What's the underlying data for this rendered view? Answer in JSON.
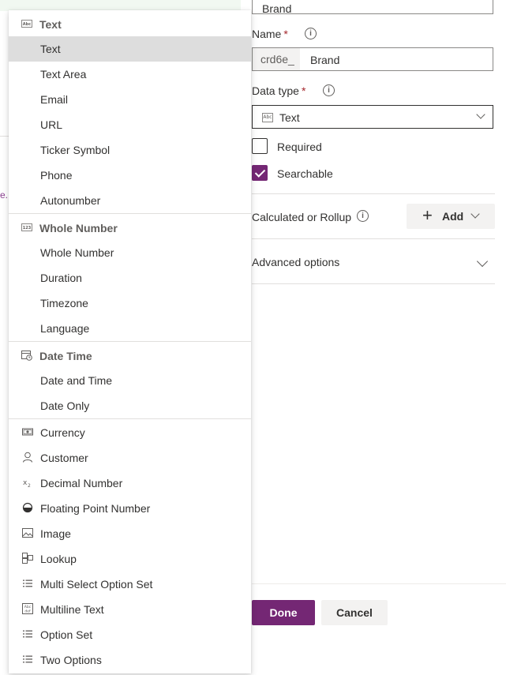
{
  "panel": {
    "top_field_value": "Brand",
    "name_label": "Name",
    "required_mark": "*",
    "info_glyph": "i",
    "name_prefix": "crd6e_",
    "name_value": "Brand",
    "data_type_label": "Data type",
    "data_type_value": "Text",
    "data_type_icon_text": "Abc",
    "required_label": "Required",
    "required_checked": false,
    "searchable_label": "Searchable",
    "searchable_checked": true,
    "calc_label": "Calculated or Rollup",
    "add_label": "Add",
    "advanced_label": "Advanced options",
    "done_label": "Done",
    "cancel_label": "Cancel",
    "accent_color": "#742774"
  },
  "background": {
    "fragment": "e."
  },
  "dropdown": {
    "groups": [
      {
        "header": "Text",
        "icon": "text-abc-icon",
        "items": [
          "Text",
          "Text Area",
          "Email",
          "URL",
          "Ticker Symbol",
          "Phone",
          "Autonumber"
        ]
      },
      {
        "header": "Whole Number",
        "icon": "number-123-icon",
        "items": [
          "Whole Number",
          "Duration",
          "Timezone",
          "Language"
        ]
      },
      {
        "header": "Date Time",
        "icon": "calendar-clock-icon",
        "items": [
          "Date and Time",
          "Date Only"
        ]
      }
    ],
    "selected": "Text",
    "other_items": [
      {
        "label": "Currency",
        "icon": "currency-icon"
      },
      {
        "label": "Customer",
        "icon": "person-icon"
      },
      {
        "label": "Decimal Number",
        "icon": "decimal-icon"
      },
      {
        "label": "Floating Point Number",
        "icon": "half-circle-icon"
      },
      {
        "label": "Image",
        "icon": "image-icon"
      },
      {
        "label": "Lookup",
        "icon": "lookup-icon"
      },
      {
        "label": "Multi Select Option Set",
        "icon": "list-icon"
      },
      {
        "label": "Multiline Text",
        "icon": "multiline-text-icon"
      },
      {
        "label": "Option Set",
        "icon": "list-icon"
      },
      {
        "label": "Two Options",
        "icon": "list-icon"
      }
    ]
  }
}
